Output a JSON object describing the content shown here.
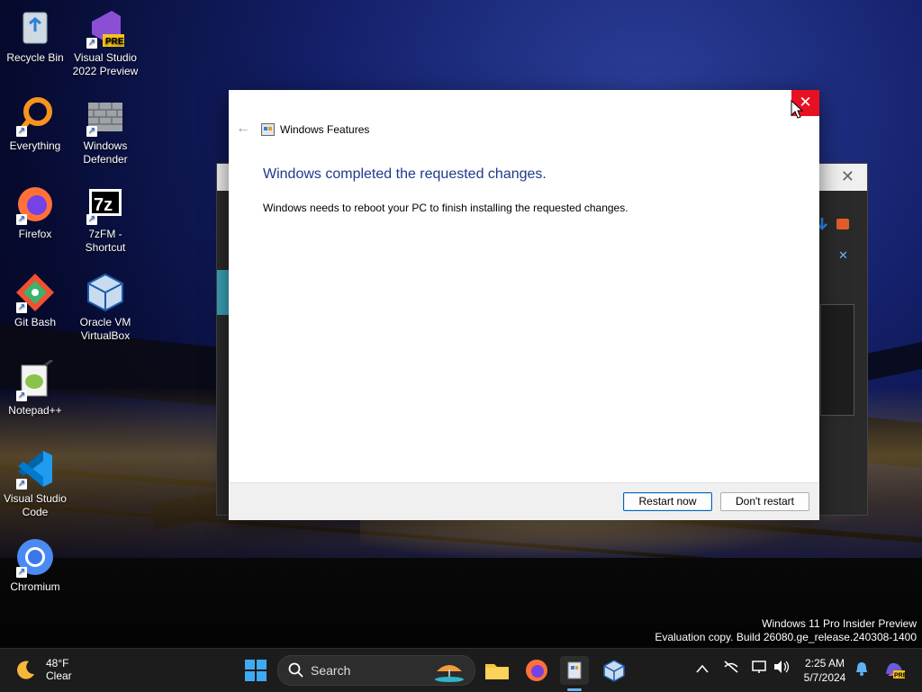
{
  "desktop_icons": [
    {
      "label": "Recycle Bin"
    },
    {
      "label": "Visual Studio 2022 Preview"
    },
    {
      "label": "Everything"
    },
    {
      "label": "Windows Defender"
    },
    {
      "label": "Firefox"
    },
    {
      "label": "7zFM - Shortcut"
    },
    {
      "label": "Git Bash"
    },
    {
      "label": "Oracle VM VirtualBox"
    },
    {
      "label": "Notepad++"
    },
    {
      "label": "Visual Studio Code"
    },
    {
      "label": "Chromium"
    }
  ],
  "dialog": {
    "title": "Windows Features",
    "heading": "Windows completed the requested changes.",
    "message": "Windows needs to reboot your PC to finish installing the requested changes.",
    "primary_button": "Restart now",
    "secondary_button": "Don't restart",
    "close_glyph": "✕",
    "back_glyph": "←"
  },
  "watermark": {
    "line1": "Windows 11 Pro Insider Preview",
    "line2": "Evaluation copy. Build 26080.ge_release.240308-1400"
  },
  "taskbar": {
    "weather_temp": "48°F",
    "weather_cond": "Clear",
    "search_placeholder": "Search",
    "time": "2:25 AM",
    "date": "5/7/2024"
  },
  "colors": {
    "accent": "#0067c0",
    "close_red": "#e81123",
    "heading_blue": "#1e3a8a"
  }
}
